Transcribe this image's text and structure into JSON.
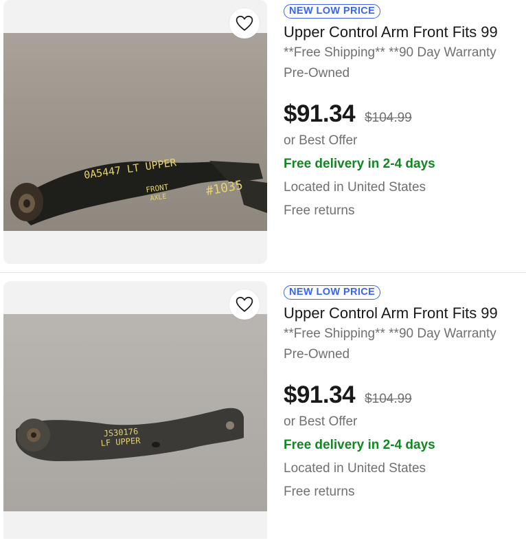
{
  "listings": [
    {
      "badge": "NEW LOW PRICE",
      "title": "Upper Control Arm Front Fits 99",
      "subtitle": "**Free Shipping** **90 Day Warranty",
      "condition": "Pre-Owned",
      "price": "$91.34",
      "original_price": "$104.99",
      "best_offer": "or Best Offer",
      "delivery": "Free delivery in 2-4 days",
      "location": "Located in United States",
      "returns": "Free returns",
      "photo_text": [
        "0A5447 LT UPPER",
        "FRONT",
        "AXLE",
        "#1035"
      ]
    },
    {
      "badge": "NEW LOW PRICE",
      "title": "Upper Control Arm Front Fits 99",
      "subtitle": "**Free Shipping** **90 Day Warranty",
      "condition": "Pre-Owned",
      "price": "$91.34",
      "original_price": "$104.99",
      "best_offer": "or Best Offer",
      "delivery": "Free delivery in 2-4 days",
      "location": "Located in United States",
      "returns": "Free returns",
      "photo_text": [
        "JS30176",
        "LF UPPER"
      ]
    }
  ],
  "icons": {
    "watch": "heart-outline-icon"
  },
  "colors": {
    "badge": "#3665f3",
    "delivery": "#118722",
    "muted": "#707070",
    "text": "#191919"
  }
}
